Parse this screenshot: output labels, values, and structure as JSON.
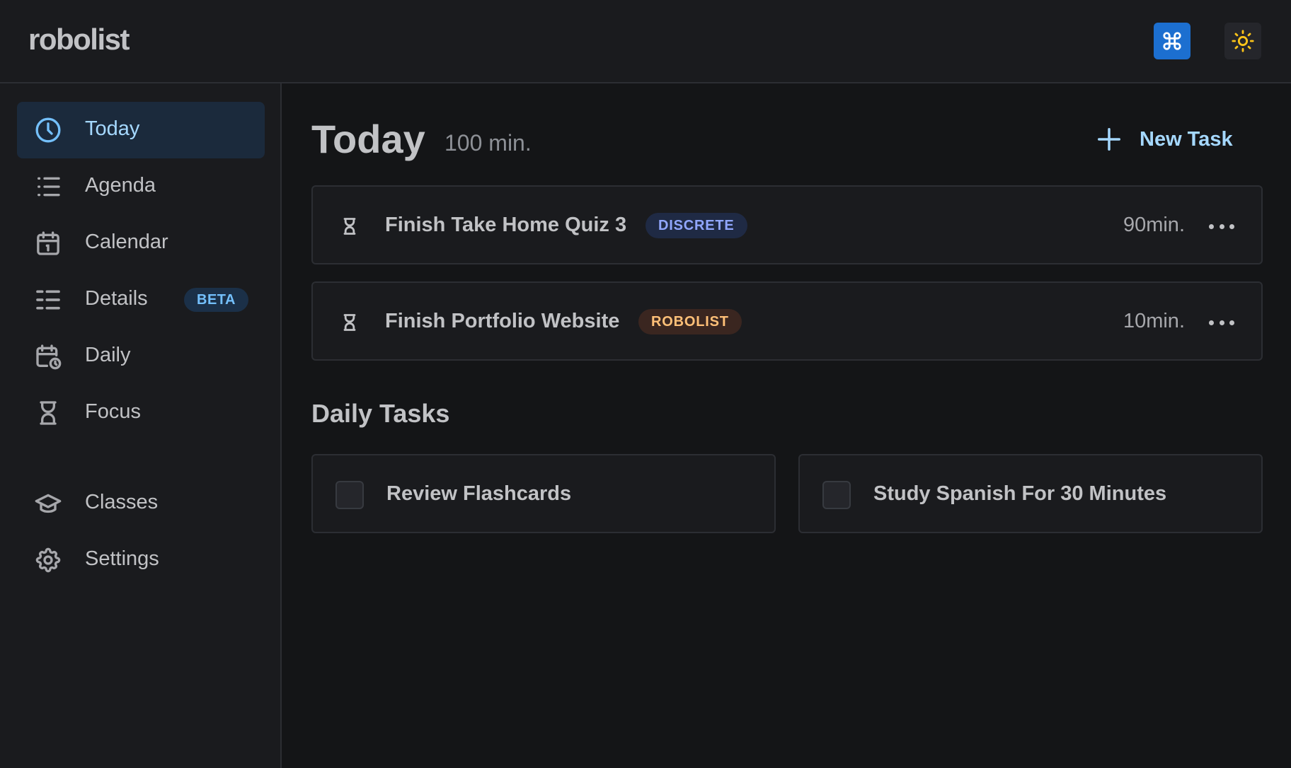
{
  "app": {
    "logo": "robolist",
    "command_icon": "command-icon",
    "theme_icon": "sun-icon",
    "accent_color": "#1c6fd0"
  },
  "sidebar": {
    "items": [
      {
        "label": "Today",
        "icon": "clock-icon",
        "active": true
      },
      {
        "label": "Agenda",
        "icon": "list-icon"
      },
      {
        "label": "Calendar",
        "icon": "calendar-icon"
      },
      {
        "label": "Details",
        "icon": "details-list-icon",
        "badge": "BETA"
      },
      {
        "label": "Daily",
        "icon": "calendar-clock-icon"
      },
      {
        "label": "Focus",
        "icon": "hourglass-icon"
      },
      {
        "label": "Classes",
        "icon": "graduation-cap-icon"
      },
      {
        "label": "Settings",
        "icon": "gear-icon"
      }
    ]
  },
  "main": {
    "title": "Today",
    "total_time": "100 min.",
    "new_task_label": "New Task",
    "tasks": [
      {
        "title": "Finish Take Home Quiz 3",
        "tag": "DISCRETE",
        "duration": "90min."
      },
      {
        "title": "Finish Portfolio Website",
        "tag": "ROBOLIST",
        "duration": "10min."
      }
    ],
    "daily_section_title": "Daily Tasks",
    "daily_tasks": [
      {
        "label": "Review Flashcards",
        "checked": false
      },
      {
        "label": "Study Spanish For 30 Minutes",
        "checked": false
      }
    ]
  }
}
